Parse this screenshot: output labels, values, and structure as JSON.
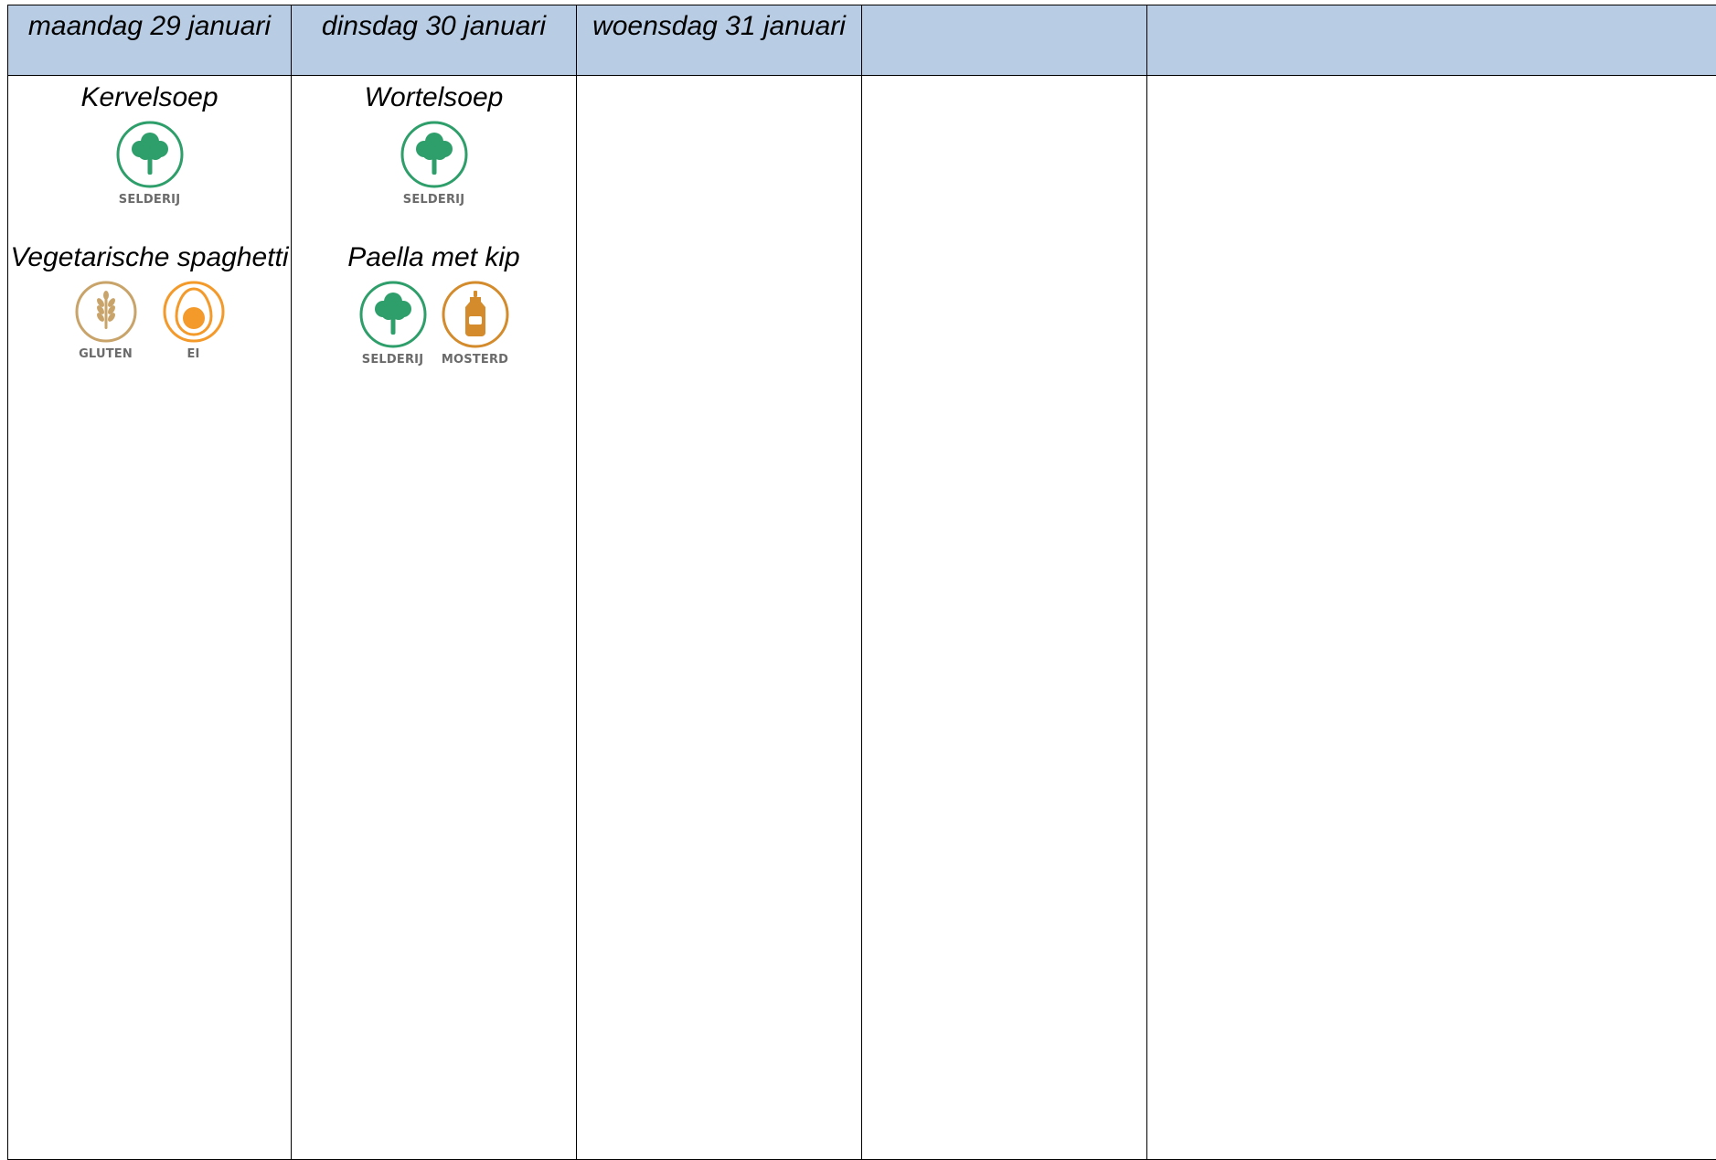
{
  "columns": [
    {
      "date": "maandag 29 januari",
      "dishes": [
        {
          "name": "Kervelsoep",
          "allergens": [
            {
              "icon": "celery-icon",
              "label": "SELDERIJ"
            }
          ]
        },
        {
          "name": "Vegetarische spaghetti",
          "allergens": [
            {
              "icon": "wheat-icon",
              "label": "GLUTEN"
            },
            {
              "icon": "egg-icon",
              "label": "EI"
            }
          ]
        }
      ]
    },
    {
      "date": "dinsdag 30 januari",
      "dishes": [
        {
          "name": "Wortelsoep",
          "allergens": [
            {
              "icon": "celery-icon",
              "label": "SELDERIJ"
            }
          ]
        },
        {
          "name": "Paella met kip",
          "allergens": [
            {
              "icon": "celery-icon",
              "label": "SELDERIJ"
            },
            {
              "icon": "mustard-icon",
              "label": "MOSTERD"
            }
          ]
        }
      ]
    },
    {
      "date": "woensdag 31 januari",
      "dishes": []
    },
    {
      "date": "",
      "dishes": []
    },
    {
      "date": "",
      "dishes": []
    }
  ],
  "colors": {
    "header_bg": "#b8cce4",
    "celery": "#2e9e6a",
    "gluten": "#c9a46a",
    "egg": "#f39a2b",
    "mustard": "#d38b2c"
  }
}
